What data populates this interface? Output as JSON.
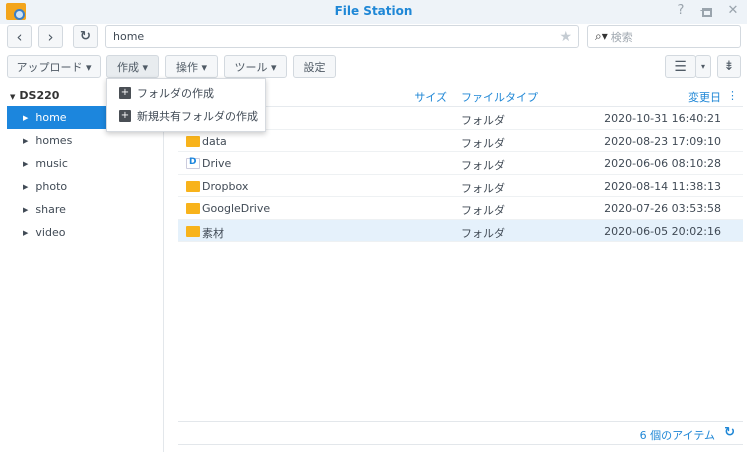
{
  "window": {
    "title": "File Station",
    "help": "?",
    "minimize": "–",
    "maximize": "▫",
    "close": "✕"
  },
  "nav": {
    "back": "‹",
    "forward": "›",
    "refresh": "↻",
    "path": "home",
    "star": "★",
    "search_placeholder": "検索",
    "search_icon": "⌕▾"
  },
  "toolbar": {
    "upload": "アップロード ▾",
    "create": "作成 ▾",
    "action": "操作 ▾",
    "tools": "ツール ▾",
    "settings": "設定",
    "view": "☰",
    "view_dd": "▾",
    "sort": "⇟"
  },
  "create_menu": [
    "フォルダの作成",
    "新規共有フォルダの作成"
  ],
  "sidebar": {
    "root": "DS220",
    "items": [
      "home",
      "homes",
      "music",
      "photo",
      "share",
      "video"
    ]
  },
  "columns": {
    "size": "サイズ",
    "type": "ファイルタイプ",
    "modified": "変更日",
    "more": "⋮"
  },
  "files": [
    {
      "name": "",
      "type": "フォルダ",
      "modified": "2020-10-31 16:40:21",
      "icon": "folder"
    },
    {
      "name": "data",
      "type": "フォルダ",
      "modified": "2020-08-23 17:09:10",
      "icon": "folder"
    },
    {
      "name": "Drive",
      "type": "フォルダ",
      "modified": "2020-06-06 08:10:28",
      "icon": "drive"
    },
    {
      "name": "Dropbox",
      "type": "フォルダ",
      "modified": "2020-08-14 11:38:13",
      "icon": "folder"
    },
    {
      "name": "GoogleDrive",
      "type": "フォルダ",
      "modified": "2020-07-26 03:53:58",
      "icon": "folder"
    },
    {
      "name": "素材",
      "type": "フォルダ",
      "modified": "2020-06-05 20:02:16",
      "icon": "folder"
    }
  ],
  "footer": {
    "count": "6 個のアイテム",
    "refresh": "↻"
  }
}
